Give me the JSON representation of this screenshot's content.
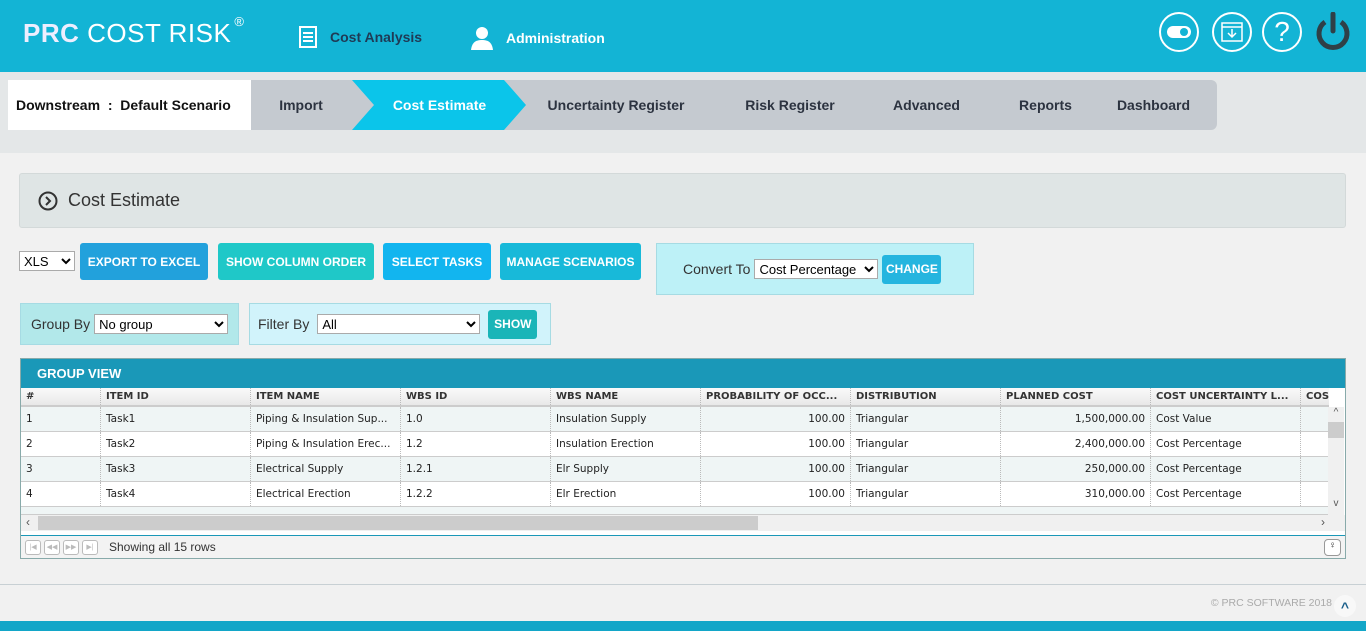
{
  "header": {
    "logo_bold": "PRC",
    "logo_rest": "COST RISK",
    "logo_mark": "®",
    "nav": [
      {
        "label": "Cost Analysis",
        "icon": "list-document-icon"
      },
      {
        "label": "Administration",
        "icon": "user-icon"
      }
    ],
    "icons": [
      "toggle-icon",
      "download-window-icon",
      "help-icon",
      "power-icon"
    ]
  },
  "context": {
    "project": "Downstream",
    "sep": ":",
    "scenario": "Default Scenario"
  },
  "steps": [
    "Import",
    "Cost Estimate",
    "Uncertainty Register",
    "Risk Register",
    "Advanced",
    "Reports",
    "Dashboard"
  ],
  "active_step": "Cost Estimate",
  "panel": {
    "title": "Cost Estimate"
  },
  "toolbar": {
    "format": "XLS",
    "export": "EXPORT TO EXCEL",
    "column_order": "SHOW COLUMN ORDER",
    "select_tasks": "SELECT TASKS",
    "manage": "MANAGE SCENARIOS",
    "convert_label": "Convert To",
    "convert_value": "Cost Percentage",
    "change": "CHANGE"
  },
  "filters": {
    "group_label": "Group By",
    "group_value": "No group",
    "filter_label": "Filter By",
    "filter_value": "All",
    "show": "SHOW"
  },
  "grid": {
    "title": "GROUP VIEW",
    "columns": [
      "#",
      "ITEM ID",
      "ITEM NAME",
      "WBS ID",
      "WBS NAME",
      "PROBABILITY OF OCC...",
      "DISTRIBUTION",
      "PLANNED COST",
      "COST UNCERTAINTY L...",
      "COST M"
    ],
    "rows": [
      [
        "1",
        "Task1",
        "Piping & Insulation Sup...",
        "1.0",
        "Insulation Supply",
        "100.00",
        "Triangular",
        "1,500,000.00",
        "Cost Value",
        ""
      ],
      [
        "2",
        "Task2",
        "Piping & Insulation Erec...",
        "1.2",
        "Insulation Erection",
        "100.00",
        "Triangular",
        "2,400,000.00",
        "Cost Percentage",
        ""
      ],
      [
        "3",
        "Task3",
        "Electrical Supply",
        "1.2.1",
        "Elr Supply",
        "100.00",
        "Triangular",
        "250,000.00",
        "Cost Percentage",
        ""
      ],
      [
        "4",
        "Task4",
        "Electrical Erection",
        "1.2.2",
        "Elr Erection",
        "100.00",
        "Triangular",
        "310,000.00",
        "Cost Percentage",
        ""
      ]
    ],
    "status": "Showing all 15 rows"
  },
  "footer": {
    "copyright": "© PRC SOFTWARE 2018"
  }
}
